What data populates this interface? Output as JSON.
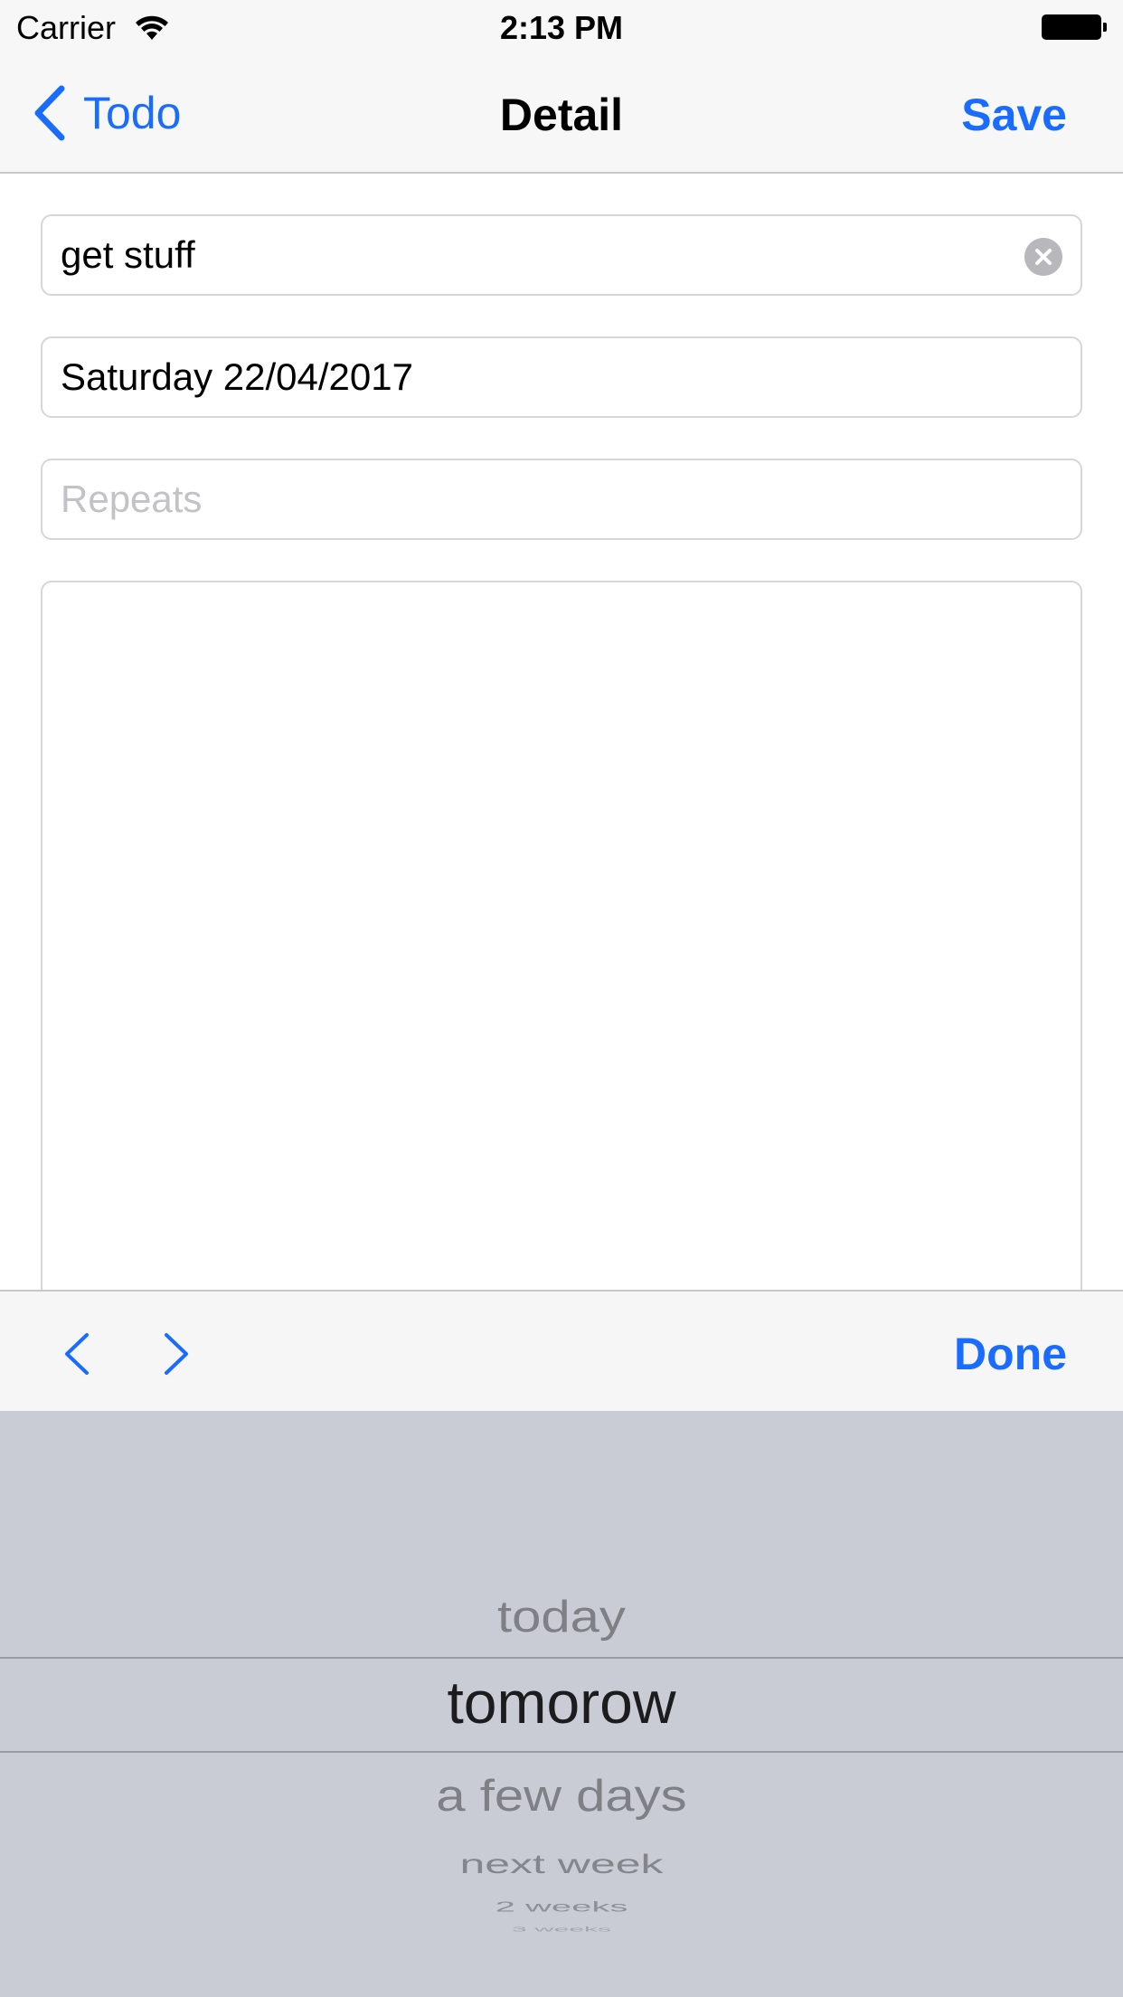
{
  "status_bar": {
    "carrier": "Carrier",
    "time": "2:13 PM"
  },
  "nav": {
    "back_label": "Todo",
    "title": "Detail",
    "save_label": "Save"
  },
  "form": {
    "title_value": "get stuff",
    "date_value": "Saturday 22/04/2017",
    "repeats_placeholder": "Repeats",
    "notes_value": ""
  },
  "toolbar": {
    "done_label": "Done"
  },
  "picker": {
    "options": [
      "today",
      "tomorow",
      "a few days",
      "next week",
      "2 weeks",
      "3 weeks"
    ],
    "selected": "tomorow"
  },
  "colors": {
    "accent": "#1a6cff",
    "bar_background": "#f7f7f7",
    "picker_background": "#c9ccd4"
  },
  "icons": [
    "wifi-icon",
    "battery-icon",
    "back-chevron-icon",
    "clear-icon",
    "chevron-left-icon",
    "chevron-right-icon"
  ]
}
